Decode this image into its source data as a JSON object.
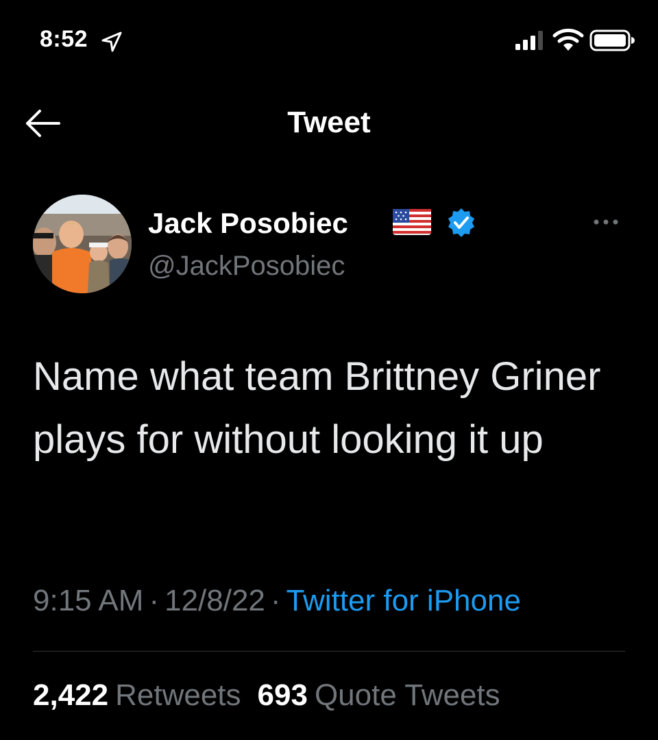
{
  "status_bar": {
    "time": "8:52",
    "location_icon": "location-arrow-icon",
    "signal_icon": "cellular-signal-icon",
    "wifi_icon": "wifi-icon",
    "battery_icon": "battery-icon"
  },
  "nav": {
    "back_icon": "back-arrow-icon",
    "title": "Tweet"
  },
  "tweet": {
    "author_name": "Jack Posobiec",
    "author_handle": "@JackPosobiec",
    "flag_icon": "us-flag-emoji",
    "verified_icon": "verified-badge-icon",
    "more_icon": "more-options-icon",
    "text": "Name what team Brittney Griner plays for without looking it up",
    "time": "9:15 AM",
    "date": "12/8/22",
    "meta_separator": "·",
    "source": "Twitter for iPhone",
    "stats": [
      {
        "count": "2,422",
        "label": "Retweets"
      },
      {
        "count": "693",
        "label": "Quote Tweets"
      }
    ]
  },
  "colors": {
    "background": "#000000",
    "text": "#e7e9ea",
    "secondary_text": "#71767b",
    "accent": "#1d9bf0",
    "divider": "#2f3336"
  }
}
